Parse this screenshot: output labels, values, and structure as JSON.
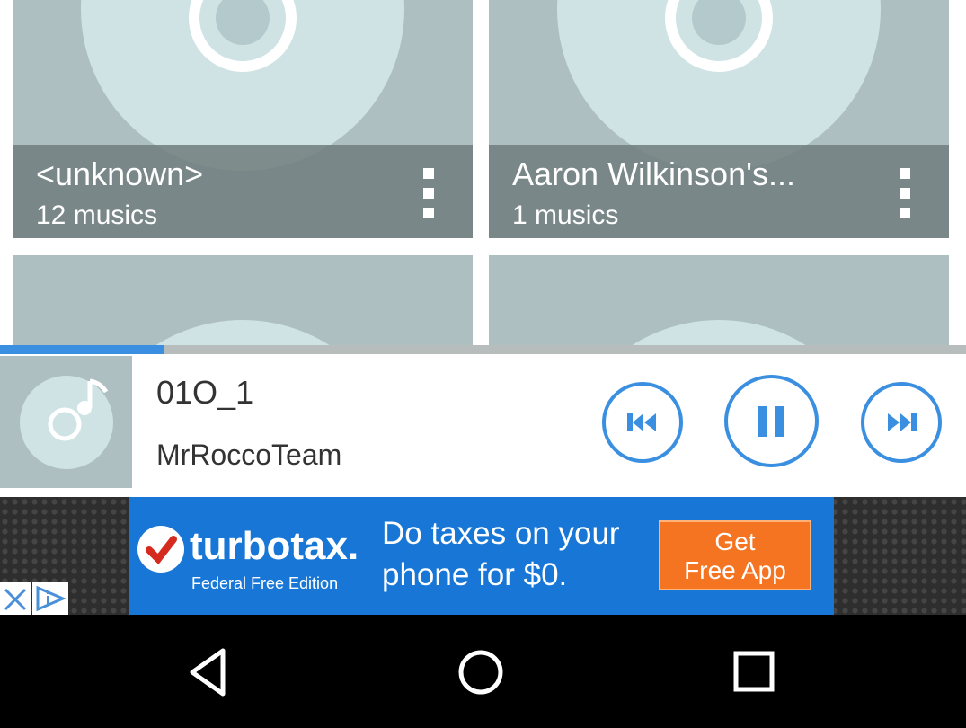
{
  "albums": [
    {
      "title": "<unknown>",
      "count": "12 musics"
    },
    {
      "title": "Aaron Wilkinson's...",
      "count": "1 musics"
    },
    {
      "title": "",
      "count": ""
    },
    {
      "title": "",
      "count": ""
    }
  ],
  "player": {
    "track_title": "01O_1",
    "artist": "MrRoccoTeam",
    "progress_fraction": 0.17
  },
  "ad": {
    "brand": "turbotax.",
    "edition": "Federal Free Edition",
    "headline_line1": "Do taxes on your",
    "headline_line2": "phone for $0.",
    "cta_line1": "Get",
    "cta_line2": "Free App"
  },
  "icons": {
    "album_menu": "more-vert-icon",
    "album_art": "cd-disc-icon",
    "track_art": "music-note-disc-icon",
    "prev": "skip-previous-icon",
    "pause": "pause-icon",
    "next": "skip-next-icon",
    "ad_close": "close-icon",
    "ad_info": "adchoices-icon",
    "nav_back": "back-triangle-icon",
    "nav_home": "home-circle-icon",
    "nav_recents": "recents-square-icon"
  },
  "colors": {
    "accent": "#3a8fe0",
    "card_bg": "#aebfc1",
    "overlay": "#738080",
    "ad_bg": "#1877d6",
    "ad_cta": "#f47421"
  }
}
